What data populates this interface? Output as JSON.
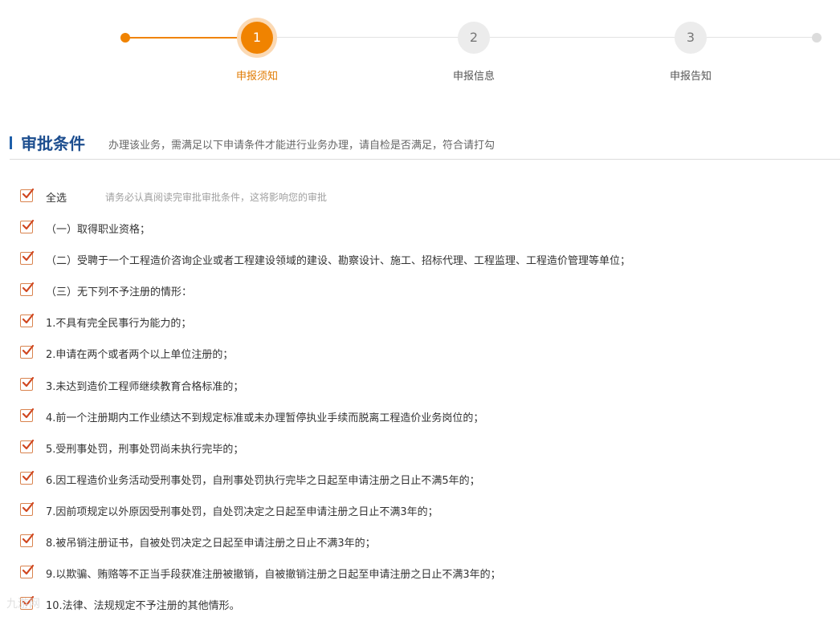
{
  "colors": {
    "accent": "#f08300",
    "title_blue": "#1d4e8f",
    "checkbox": "#d9834e"
  },
  "steps": [
    {
      "number": "1",
      "label": "申报须知",
      "state": "active"
    },
    {
      "number": "2",
      "label": "申报信息",
      "state": "todo"
    },
    {
      "number": "3",
      "label": "申报告知",
      "state": "todo"
    }
  ],
  "section": {
    "title": "审批条件",
    "description": "办理该业务，需满足以下申请条件才能进行业务办理，请自检是否满足，符合请打勾"
  },
  "select_all": {
    "label": "全选",
    "hint": "请务必认真阅读完审批审批条件，这将影响您的审批",
    "checked": true
  },
  "conditions": [
    {
      "text": "（一）取得职业资格；",
      "checked": true
    },
    {
      "text": "（二）受聘于一个工程造价咨询企业或者工程建设领域的建设、勘察设计、施工、招标代理、工程监理、工程造价管理等单位；",
      "checked": true
    },
    {
      "text": "（三）无下列不予注册的情形：",
      "checked": true
    },
    {
      "text": "1.不具有完全民事行为能力的；",
      "checked": true
    },
    {
      "text": "2.申请在两个或者两个以上单位注册的；",
      "checked": true
    },
    {
      "text": "3.未达到造价工程师继续教育合格标准的；",
      "checked": true
    },
    {
      "text": "4.前一个注册期内工作业绩达不到规定标准或未办理暂停执业手续而脱离工程造价业务岗位的；",
      "checked": true
    },
    {
      "text": "5.受刑事处罚，刑事处罚尚未执行完毕的；",
      "checked": true
    },
    {
      "text": "6.因工程造价业务活动受刑事处罚，自刑事处罚执行完毕之日起至申请注册之日止不满5年的；",
      "checked": true
    },
    {
      "text": "7.因前项规定以外原因受刑事处罚，自处罚决定之日起至申请注册之日止不满3年的；",
      "checked": true
    },
    {
      "text": "8.被吊销注册证书，自被处罚决定之日起至申请注册之日止不满3年的；",
      "checked": true
    },
    {
      "text": "9.以欺骗、贿赂等不正当手段获准注册被撤销，自被撤销注册之日起至申请注册之日止不满3年的；",
      "checked": true
    },
    {
      "text": "10.法律、法规规定不予注册的其他情形。",
      "checked": true
    }
  ],
  "watermark": "九游网"
}
